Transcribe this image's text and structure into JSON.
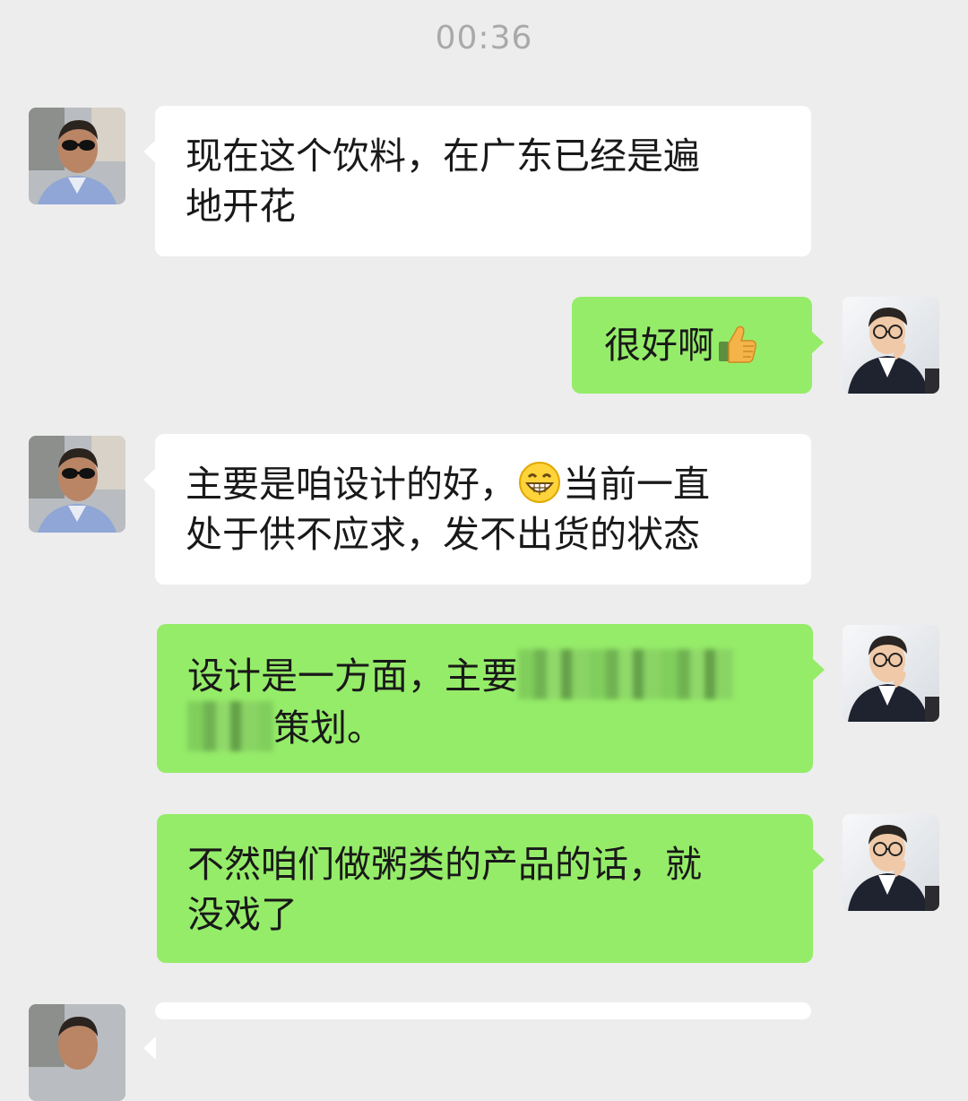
{
  "timestamp": "00:36",
  "colors": {
    "background": "#ededed",
    "incoming_bubble": "#ffffff",
    "outgoing_bubble": "#95ec69",
    "timestamp_text": "#a9a9a9"
  },
  "messages": [
    {
      "direction": "incoming",
      "sender_avatar": "avatar-man-sunglasses",
      "lines": [
        "现在这个饮料，在广东已经是遍",
        "地开花"
      ]
    },
    {
      "direction": "outgoing",
      "sender_avatar": "avatar-man-glasses-suit",
      "text": "很好啊",
      "emoji": "thumbs-up-icon"
    },
    {
      "direction": "incoming",
      "sender_avatar": "avatar-man-sunglasses",
      "line1_a": "主要是咱设计的好，",
      "emoji": "grinning-face-icon",
      "line1_b": "当前一直",
      "line2": "处于供不应求，发不出货的状态"
    },
    {
      "direction": "outgoing",
      "sender_avatar": "avatar-man-glasses-suit",
      "line1_a": "设计是一方面，主要",
      "line2_b": "策划。",
      "redacted": true
    },
    {
      "direction": "outgoing",
      "sender_avatar": "avatar-man-glasses-suit",
      "lines": [
        "不然咱们做粥类的产品的话，就",
        "没戏了"
      ]
    }
  ]
}
